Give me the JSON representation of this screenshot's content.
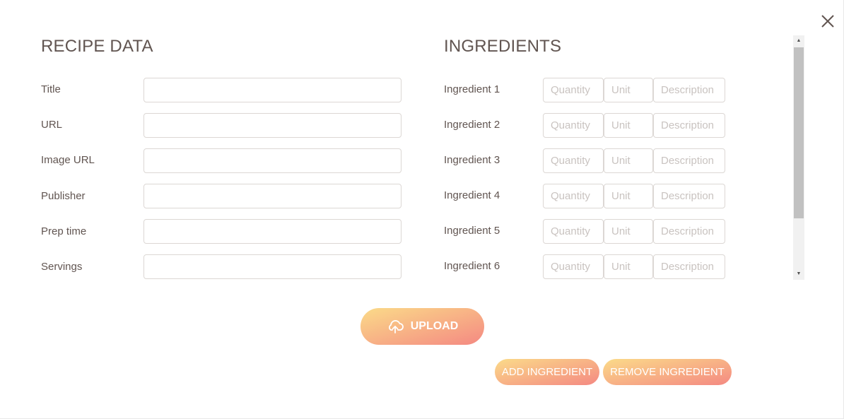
{
  "recipe": {
    "heading": "RECIPE DATA",
    "fields": [
      {
        "label": "Title",
        "value": ""
      },
      {
        "label": "URL",
        "value": ""
      },
      {
        "label": "Image URL",
        "value": ""
      },
      {
        "label": "Publisher",
        "value": ""
      },
      {
        "label": "Prep time",
        "value": ""
      },
      {
        "label": "Servings",
        "value": ""
      }
    ]
  },
  "ingredients": {
    "heading": "INGREDIENTS",
    "placeholders": {
      "quantity": "Quantity",
      "unit": "Unit",
      "description": "Description"
    },
    "rows": [
      {
        "label": "Ingredient 1"
      },
      {
        "label": "Ingredient 2"
      },
      {
        "label": "Ingredient 3"
      },
      {
        "label": "Ingredient 4"
      },
      {
        "label": "Ingredient 5"
      },
      {
        "label": "Ingredient 6"
      }
    ]
  },
  "buttons": {
    "upload": "UPLOAD",
    "add_ingredient": "ADD INGREDIENT",
    "remove_ingredient": "REMOVE INGREDIENT"
  },
  "icons": {
    "close": "close-icon",
    "upload": "cloud-upload-icon"
  },
  "colors": {
    "text": "#615551",
    "gradient_start": "#fbdb89",
    "gradient_end": "#f48982"
  }
}
